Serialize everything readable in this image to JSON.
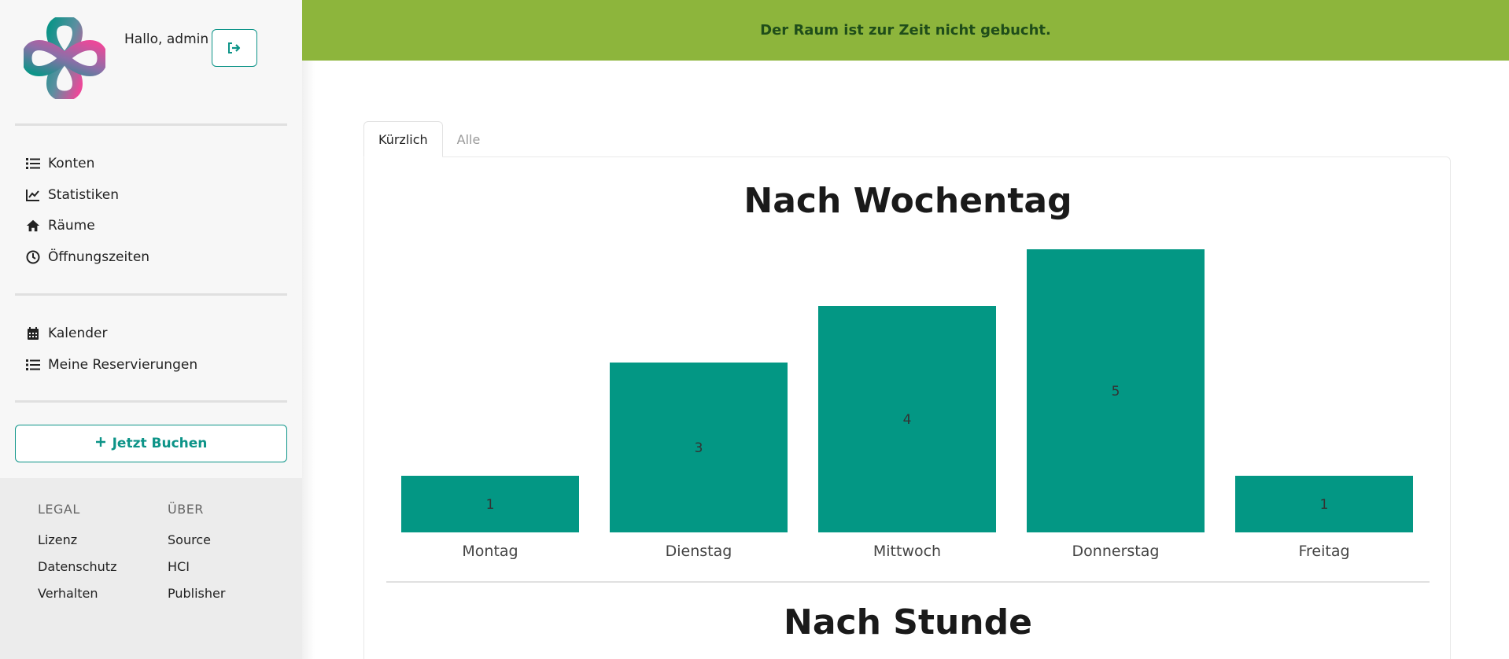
{
  "banner": {
    "text": "Der Raum ist zur Zeit nicht gebucht."
  },
  "user": {
    "greeting": "Hallo, admin"
  },
  "nav": {
    "group1": [
      {
        "label": "Konten",
        "icon": "list-icon"
      },
      {
        "label": "Statistiken",
        "icon": "chart-line-icon"
      },
      {
        "label": "Räume",
        "icon": "home-icon"
      },
      {
        "label": "Öffnungszeiten",
        "icon": "clock-icon"
      }
    ],
    "group2": [
      {
        "label": "Kalender",
        "icon": "calendar-icon"
      },
      {
        "label": "Meine Reservierungen",
        "icon": "list-icon"
      }
    ]
  },
  "book_button": {
    "label": "Jetzt Buchen"
  },
  "footer": {
    "legal": {
      "heading": "LEGAL",
      "links": [
        "Lizenz",
        "Datenschutz",
        "Verhalten"
      ]
    },
    "about": {
      "heading": "ÜBER",
      "links": [
        "Source",
        "HCI",
        "Publisher"
      ]
    }
  },
  "tabs": [
    {
      "label": "Kürzlich",
      "active": true
    },
    {
      "label": "Alle",
      "active": false
    }
  ],
  "colors": {
    "accent": "#0d9488",
    "bar": "#039784",
    "banner": "#8db53c"
  },
  "chart_data": [
    {
      "type": "bar",
      "title": "Nach Wochentag",
      "categories": [
        "Montag",
        "Dienstag",
        "Mittwoch",
        "Donnerstag",
        "Freitag"
      ],
      "values": [
        1,
        3,
        4,
        5,
        1
      ],
      "ylim": [
        0,
        5
      ],
      "grid": false
    },
    {
      "type": "bar",
      "title": "Nach Stunde"
    }
  ]
}
